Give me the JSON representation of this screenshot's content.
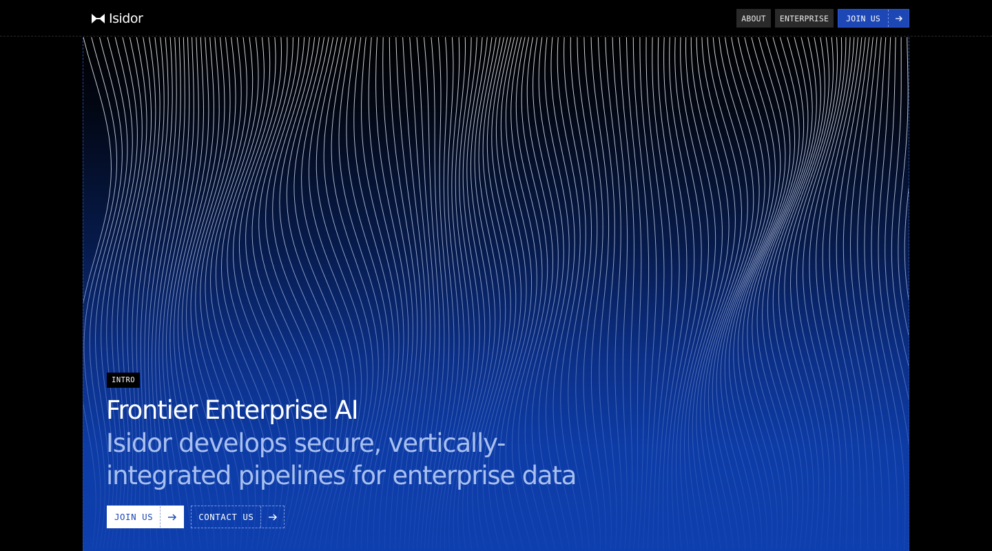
{
  "brand": {
    "name": "Isidor",
    "logo_icon": "bowtie-logo-icon"
  },
  "nav": {
    "about_label": "ABOUT",
    "enterprise_label": "ENTERPRISE",
    "join_label": "JOIN US",
    "join_icon": "arrow-right-icon"
  },
  "hero": {
    "tag": "INTRO",
    "title": "Frontier Enterprise AI",
    "subtitle": "Isidor develops secure, vertically-integrated pipelines for enterprise data",
    "cta_join_label": "JOIN US",
    "cta_contact_label": "CONTACT US"
  },
  "colors": {
    "accent": "#1d47b5",
    "background": "#000000",
    "hero_bottom": "#0e3fae",
    "subtitle": "#a9c0ef"
  }
}
